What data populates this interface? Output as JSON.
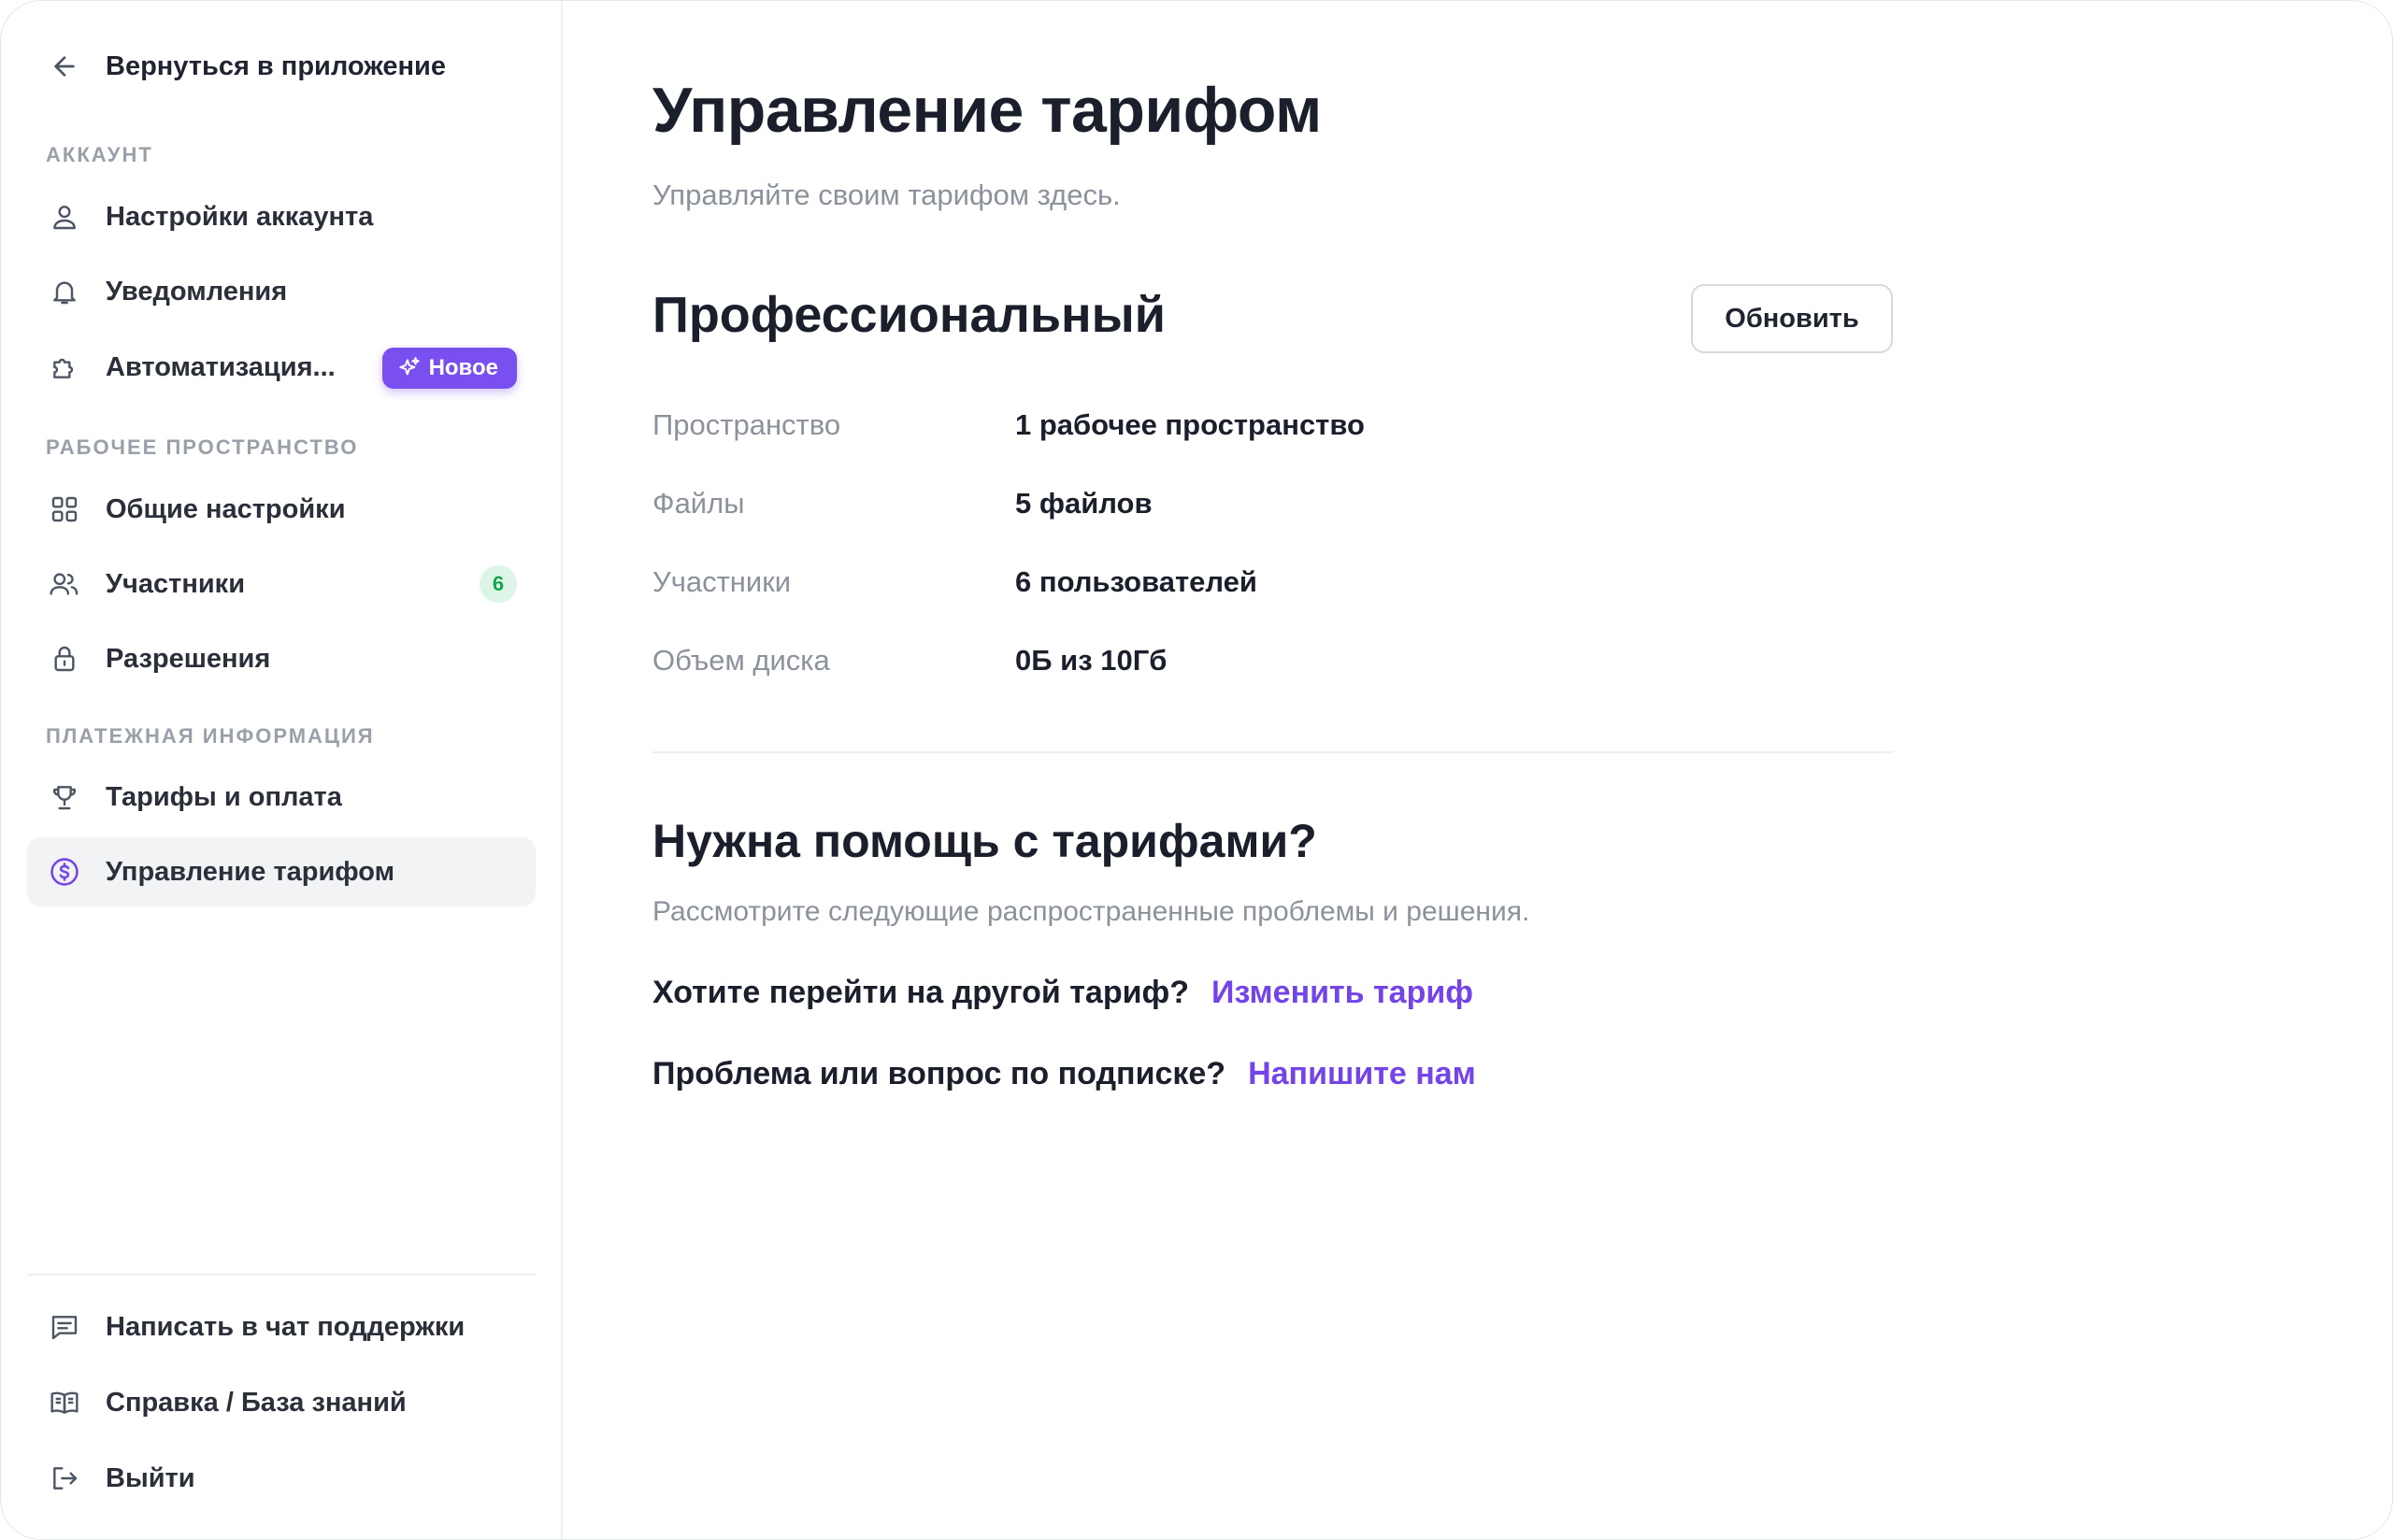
{
  "sidebar": {
    "back_label": "Вернуться в приложение",
    "sections": [
      {
        "title": "Аккаунт"
      },
      {
        "title": "Рабочее пространство"
      },
      {
        "title": "Платежная информация"
      }
    ],
    "items": [
      {
        "label": "Настройки аккаунта",
        "icon": "user-icon"
      },
      {
        "label": "Уведомления",
        "icon": "bell-icon"
      },
      {
        "label": "Автоматизация...",
        "icon": "puzzle-icon",
        "badge": "Новое"
      },
      {
        "label": "Общие настройки",
        "icon": "grid-icon"
      },
      {
        "label": "Участники",
        "icon": "users-icon",
        "count": "6"
      },
      {
        "label": "Разрешения",
        "icon": "lock-icon"
      },
      {
        "label": "Тарифы и оплата",
        "icon": "trophy-icon"
      },
      {
        "label": "Управление тарифом",
        "icon": "dollar-circle-icon",
        "active": true
      }
    ],
    "footer": [
      {
        "label": "Написать в чат поддержки",
        "icon": "chat-icon"
      },
      {
        "label": "Справка / База знаний",
        "icon": "book-icon"
      },
      {
        "label": "Выйти",
        "icon": "logout-icon"
      }
    ]
  },
  "main": {
    "title": "Управление тарифом",
    "subtitle": "Управляйте своим тарифом здесь.",
    "plan": {
      "name": "Профессиональный",
      "update_label": "Обновить",
      "rows": [
        {
          "key": "Пространство",
          "value": "1 рабочее пространство"
        },
        {
          "key": "Файлы",
          "value": "5 файлов"
        },
        {
          "key": "Участники",
          "value": "6 пользователей"
        },
        {
          "key": "Объем диска",
          "value": "0Б из 10Гб"
        }
      ]
    },
    "help": {
      "title": "Нужна помощь с тарифами?",
      "subtitle": "Рассмотрите следующие распространенные проблемы и решения.",
      "items": [
        {
          "question": "Хотите перейти на другой тариф?",
          "link": "Изменить тариф"
        },
        {
          "question": "Проблема или вопрос по подписке?",
          "link": "Напишите нам"
        }
      ]
    }
  },
  "colors": {
    "accent": "#7444e8",
    "badge_bg": "#7a4ff0",
    "count_bg": "#dcf5e6",
    "count_text": "#16a34a",
    "active_bg": "#f2f3f5"
  }
}
